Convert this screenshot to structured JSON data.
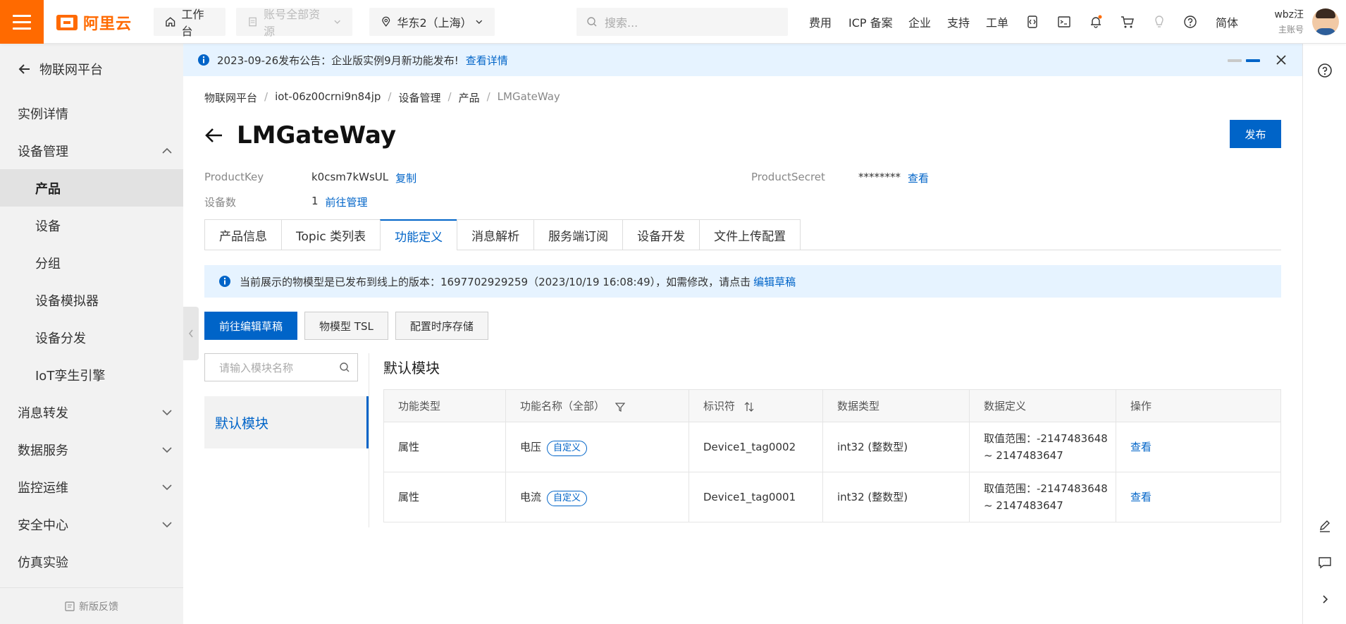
{
  "header": {
    "logo_text": "阿里云",
    "workbench": "工作台",
    "resources": "账号全部资源",
    "region": "华东2（上海）",
    "search_placeholder": "搜索...",
    "nav": [
      "费用",
      "ICP 备案",
      "企业",
      "支持",
      "工单"
    ],
    "lang": "简体",
    "user_name": "wbz汪",
    "user_role": "主账号",
    "accent": "#ff6a00"
  },
  "sidebar": {
    "back_title": "物联网平台",
    "items": [
      {
        "label": "实例详情",
        "sub": false,
        "expand": ""
      },
      {
        "label": "设备管理",
        "sub": false,
        "expand": "up"
      },
      {
        "label": "产品",
        "sub": true,
        "active": true
      },
      {
        "label": "设备",
        "sub": true
      },
      {
        "label": "分组",
        "sub": true
      },
      {
        "label": "设备模拟器",
        "sub": true
      },
      {
        "label": "设备分发",
        "sub": true
      },
      {
        "label": "IoT孪生引擎",
        "sub": true
      },
      {
        "label": "消息转发",
        "sub": false,
        "expand": "down"
      },
      {
        "label": "数据服务",
        "sub": false,
        "expand": "down"
      },
      {
        "label": "监控运维",
        "sub": false,
        "expand": "down"
      },
      {
        "label": "安全中心",
        "sub": false,
        "expand": "down"
      },
      {
        "label": "仿真实验",
        "sub": false,
        "expand": ""
      }
    ],
    "feedback": "新版反馈"
  },
  "notice": {
    "text": "2023-09-26发布公告：企业版实例9月新功能发布!",
    "link": "查看详情"
  },
  "breadcrumb": [
    "物联网平台",
    "iot-06z00crni9n84jp",
    "设备管理",
    "产品",
    "LMGateWay"
  ],
  "product": {
    "title": "LMGateWay",
    "publish": "发布",
    "product_key_label": "ProductKey",
    "product_key": "k0csm7kWsUL",
    "copy": "复制",
    "secret_label": "ProductSecret",
    "secret": "********",
    "view": "查看",
    "device_count_label": "设备数",
    "device_count": "1",
    "manage": "前往管理"
  },
  "tabs": [
    "产品信息",
    "Topic 类列表",
    "功能定义",
    "消息解析",
    "服务端订阅",
    "设备开发",
    "文件上传配置"
  ],
  "active_tab": 2,
  "info": {
    "text": "当前展示的物模型是已发布到线上的版本：1697702929259（2023/10/19 16:08:49），如需修改，请点击",
    "link": "编辑草稿"
  },
  "actions": {
    "edit_draft": "前往编辑草稿",
    "tsl": "物模型 TSL",
    "storage": "配置时序存储"
  },
  "modules": {
    "search_placeholder": "请输入模块名称",
    "items": [
      "默认模块"
    ],
    "title": "默认模块"
  },
  "table": {
    "headers": [
      "功能类型",
      "功能名称（全部）",
      "标识符",
      "数据类型",
      "数据定义",
      "操作"
    ],
    "rows": [
      {
        "type": "属性",
        "name": "电压",
        "tag": "自定义",
        "id": "Device1_tag0002",
        "dtype": "int32 (整数型)",
        "def1": "取值范围：-2147483648",
        "def2": "~ 2147483647",
        "op": "查看"
      },
      {
        "type": "属性",
        "name": "电流",
        "tag": "自定义",
        "id": "Device1_tag0001",
        "dtype": "int32 (整数型)",
        "def1": "取值范围：-2147483648",
        "def2": "~ 2147483647",
        "op": "查看"
      }
    ]
  }
}
